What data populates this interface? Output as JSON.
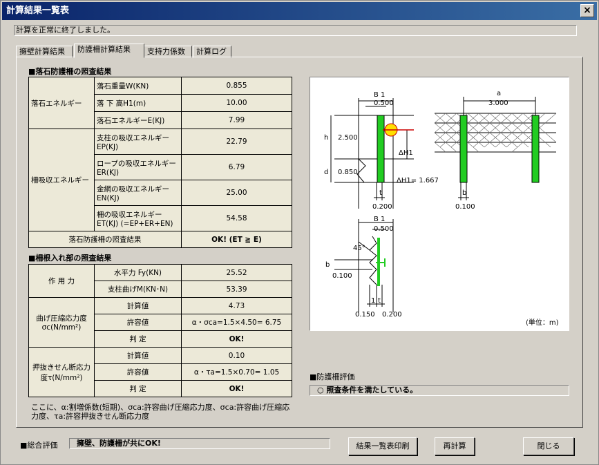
{
  "window": {
    "title": "計算結果一覧表",
    "close": "×"
  },
  "status_text": "計算を正常に終了しました。",
  "tabs": [
    "擁壁計算結果",
    "防護柵計算結果",
    "支持力係数",
    "計算ログ"
  ],
  "sec1": "■落石防護柵の照査結果",
  "t1": {
    "energy_label": "落石エネルギー",
    "weight_label": "落石重量W(KN)",
    "weight": "0.855",
    "height_label": "落 下 高H1(m)",
    "height": "10.00",
    "energy_e_label": "落石エネルギーE(KJ)",
    "energy_e": "7.99",
    "absorb_label": "柵吸収エネルギー",
    "ep_label": "支柱の吸収エネルギーEP(KJ)",
    "ep": "22.79",
    "er_label": "ロープの吸収エネルギーER(KJ)",
    "er": "6.79",
    "en_label": "金網の吸収エネルギーEN(KJ)",
    "en": "25.00",
    "et_label": "柵の吸収エネルギーET(KJ) (=EP+ER+EN)",
    "et": "54.58",
    "result_label": "落石防護柵の照査結果",
    "result": "OK! (ET ≧ E)"
  },
  "sec2": "■柵根入れ部の照査結果",
  "t2": {
    "force_label": "作 用 力",
    "fy_label": "水平力 Fy(KN)",
    "fy": "25.52",
    "m_label": "支柱曲げM(KN･N)",
    "m": "53.39",
    "sigma_label": "曲げ圧縮応力度σc(N/mm²)",
    "calc_label": "計算値",
    "sigma_calc": "4.73",
    "allow_label": "許容値",
    "sigma_allow": "α・σca=1.5×4.50= 6.75",
    "judge_label": "判 定",
    "sigma_judge": "OK!",
    "tau_label": "押抜きせん断応力度τ(N/mm²)",
    "tau_calc": "0.10",
    "tau_allow": "α・τa=1.5×0.70= 1.05",
    "tau_judge": "OK!"
  },
  "note": "ここに、α:割増係数(短期)、σca:許容曲げ圧縮応力度、σca:許容曲げ圧縮応力度、τa:許容押抜きせん断応力度",
  "diagram": {
    "b1": "B 1",
    "b1_val": "0.500",
    "h_label": "h",
    "d_label": "d",
    "h_val": "2.500",
    "d_val": "0.850",
    "dh1": "ΔH1",
    "dh1_val": "ΔH1= 1.667",
    "t": "t",
    "t_val": "0.200",
    "a_label": "a",
    "a_val": "3.000",
    "b_label": "b",
    "b_val": "0.100",
    "b1b": "B 1",
    "b1b_val": "0.500",
    "angle": "45°",
    "bb": "b",
    "bb_val": "0.100",
    "one": "1",
    "tt": "t",
    "v150": "0.150",
    "v200": "0.200",
    "unit": "(単位：m)"
  },
  "eval_title": "■防護柵評価",
  "eval_text": "○ 照査条件を満たしている。",
  "overall_label": "■総合評価",
  "overall_text": "擁壁、防護柵が共にOK!",
  "buttons": {
    "print": "結果一覧表印刷",
    "recalc": "再計算",
    "close": "閉じる"
  },
  "colors": {
    "title": "#0a246a",
    "post": "#22cc22",
    "face": "#d4d0c8"
  }
}
